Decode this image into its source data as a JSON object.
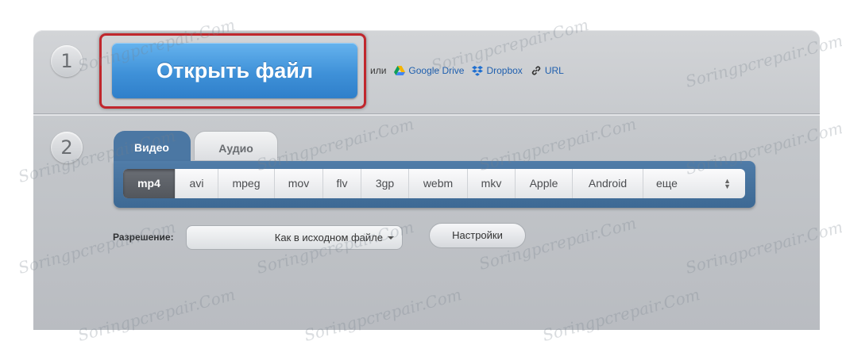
{
  "step_numbers": [
    "1",
    "2"
  ],
  "open_button_label": "Открыть файл",
  "sources": {
    "or_text": "или",
    "google_drive": "Google Drive",
    "dropbox": "Dropbox",
    "url": "URL"
  },
  "tabs": [
    {
      "label": "Видео",
      "active": true
    },
    {
      "label": "Аудио",
      "active": false
    }
  ],
  "formats": [
    "mp4",
    "avi",
    "mpeg",
    "mov",
    "flv",
    "3gp",
    "webm",
    "mkv",
    "Apple",
    "Android",
    "еще"
  ],
  "selected_format": "mp4",
  "resolution": {
    "label": "Разрешение:",
    "value": "Как в исходном файле"
  },
  "settings_label": "Настройки",
  "watermark": "Soringpcrepair.Com",
  "colors": {
    "accent_blue": "#3f91d8",
    "tab_blue": "#4b77a3",
    "highlight_red": "#c0272d"
  }
}
